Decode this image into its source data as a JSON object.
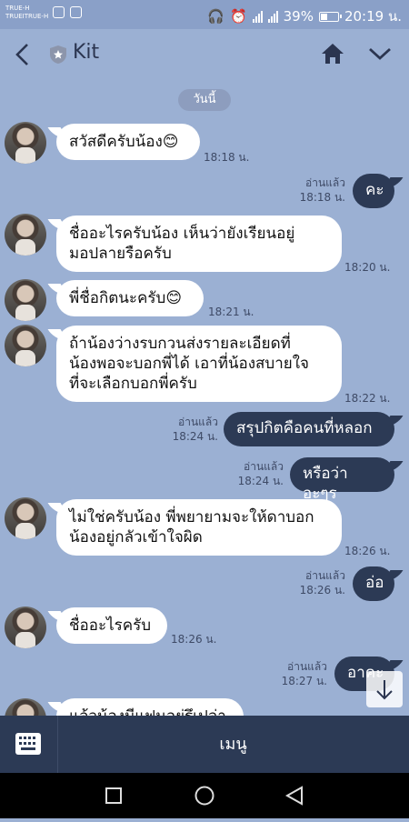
{
  "status_bar": {
    "carrier_line1": "TRUE-H",
    "carrier_line2": "TRUEITRUE-H",
    "battery": "39%",
    "time": "20:19 น."
  },
  "header": {
    "title": "Kit"
  },
  "date_divider": "วันนี้",
  "messages": [
    {
      "dir": "in",
      "text_lines": [
        "สวัสดีครับน้อง😊"
      ],
      "time": "18:18 น."
    },
    {
      "dir": "out",
      "text_lines": [
        "คะ"
      ],
      "time": "18:18 น.",
      "read": "อ่านแล้ว"
    },
    {
      "dir": "in",
      "text_lines": [
        "ชื่ออะไรครับน้อง เห็นว่ายังเรียนอยู่",
        "มอปลายรือครับ"
      ],
      "time": "18:20 น."
    },
    {
      "dir": "in",
      "text_lines": [
        "พี่ชื่อกิตนะครับ😊"
      ],
      "time": "18:21 น."
    },
    {
      "dir": "in",
      "text_lines": [
        "ถ้าน้องว่างรบกวนส่งรายละเอียดที่",
        "น้องพอจะบอกพี่ได้ เอาที่น้องสบายใจ",
        "ที่จะเลือกบอกพี่ครับ"
      ],
      "time": "18:22 น."
    },
    {
      "dir": "out",
      "text_lines": [
        "สรุปกิตคือคนที่หลอก"
      ],
      "time": "18:24 น.",
      "read": "อ่านแล้ว"
    },
    {
      "dir": "out",
      "text_lines": [
        "หรือว่าอะๆร"
      ],
      "time": "18:24 น.",
      "read": "อ่านแล้ว"
    },
    {
      "dir": "in",
      "text_lines": [
        "ไม่ใช่ครับน้อง พี่พยายามจะให้ดาบอก",
        "น้องอยู่กลัวเข้าใจผิด"
      ],
      "time": "18:26 น."
    },
    {
      "dir": "out",
      "text_lines": [
        "อ่อ"
      ],
      "time": "18:26 น.",
      "read": "อ่านแล้ว"
    },
    {
      "dir": "in",
      "text_lines": [
        "ชื่ออะไรครับ"
      ],
      "time": "18:26 น."
    },
    {
      "dir": "out",
      "text_lines": [
        "อาคะ"
      ],
      "time": "18:27 น.",
      "read": "อ่านแล้ว"
    },
    {
      "dir": "in",
      "text_lines": [
        "แล้วน้องมีแฟนอยู่รึเปล่า"
      ],
      "time": ""
    }
  ],
  "menu": {
    "label": "เมนู"
  }
}
